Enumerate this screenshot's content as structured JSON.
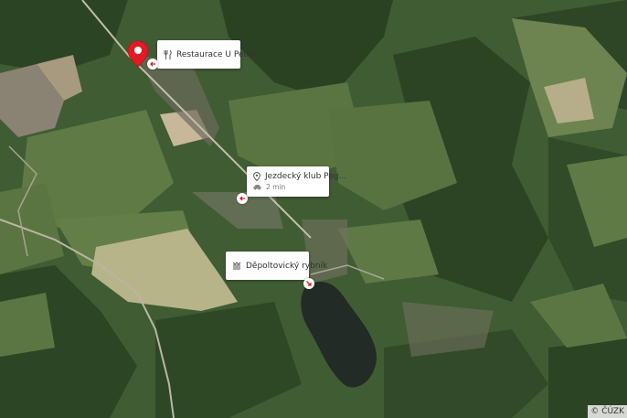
{
  "map": {
    "pois": [
      {
        "name": "Restaurace U Petrů",
        "icon": "fork-knife-icon",
        "sub": ""
      },
      {
        "name": "Jezdecký klub Peg...",
        "icon": "location-pin-icon",
        "sub": "2 min",
        "sub_icon": "car-icon"
      },
      {
        "name": "Děpoltovický rybník",
        "icon": "water-waves-icon",
        "sub": ""
      }
    ],
    "marker": {
      "icon": "location-marker-icon",
      "color": "#e01b24"
    },
    "copyright": "© ČÚZK"
  }
}
